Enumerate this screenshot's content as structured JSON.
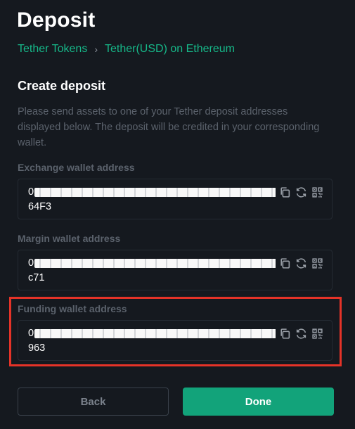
{
  "header": {
    "title": "Deposit",
    "breadcrumb": [
      "Tether Tokens",
      "Tether(USD) on Ethereum"
    ],
    "breadcrumb_separator": "›"
  },
  "section": {
    "title": "Create deposit",
    "description": "Please send assets to one of your Tether deposit addresses displayed below. The deposit will be credited in your corresponding wallet."
  },
  "wallets": [
    {
      "label": "Exchange wallet address",
      "address_start": "0",
      "address_end": "64F3"
    },
    {
      "label": "Margin wallet address",
      "address_start": "0",
      "address_end": "c71"
    },
    {
      "label": "Funding wallet address",
      "address_start": "0",
      "address_end": "963"
    }
  ],
  "icons": [
    "copy-icon",
    "refresh-icon",
    "qr-code-icon"
  ],
  "buttons": {
    "back": "Back",
    "done": "Done"
  },
  "colors": {
    "background": "#15191f",
    "accent": "#16b889",
    "primary_button": "#12a37a",
    "highlight": "#e53328",
    "muted_text": "#5b626c"
  }
}
